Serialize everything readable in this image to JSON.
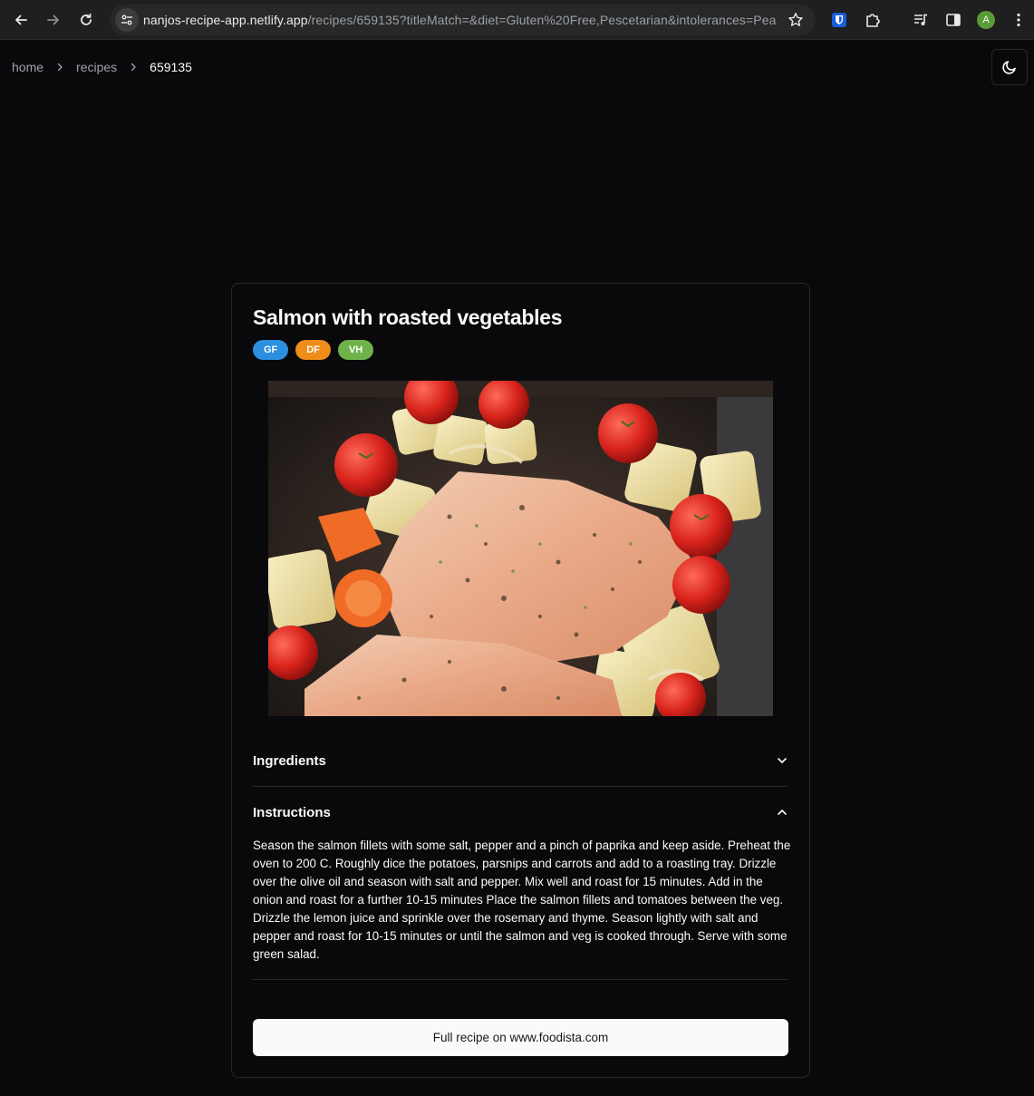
{
  "browser": {
    "url_host": "nanjos-recipe-app.netlify.app",
    "url_path": "/recipes/659135?titleMatch=&diet=Gluten%20Free,Pescetarian&intolerances=Pea...",
    "profile_initial": "A"
  },
  "breadcrumb": {
    "items": [
      "home",
      "recipes",
      "659135"
    ]
  },
  "recipe": {
    "title": "Salmon with roasted vegetables",
    "badges": [
      {
        "label": "GF",
        "color": "#2b8fe0"
      },
      {
        "label": "DF",
        "color": "#f08c1a"
      },
      {
        "label": "VH",
        "color": "#6fb24a"
      }
    ],
    "image_alt": "Salmon with roasted vegetables",
    "sections": {
      "ingredients_label": "Ingredients",
      "instructions_label": "Instructions"
    },
    "instructions": "Season the salmon fillets with some salt, pepper and a pinch of paprika and keep aside. Preheat the oven to 200 C. Roughly dice the potatoes, parsnips and carrots and add to a roasting tray. Drizzle over the olive oil and season with salt and pepper. Mix well and roast for 15 minutes. Add in the onion and roast for a further 10-15 minutes Place the salmon fillets and tomatoes between the veg. Drizzle the lemon juice and sprinkle over the rosemary and thyme. Season lightly with salt and pepper and roast for 10-15 minutes or until the salmon and veg is cooked through. Serve with some green salad.",
    "full_recipe_label": "Full recipe on www.foodista.com"
  },
  "icons": {
    "back": "arrow-left-icon",
    "forward": "arrow-right-icon",
    "reload": "reload-icon",
    "site_info": "tune-icon",
    "bookmark": "star-icon",
    "theme": "moon-icon",
    "ingredients_toggle": "chevron-down-icon",
    "instructions_toggle": "chevron-up-icon"
  }
}
